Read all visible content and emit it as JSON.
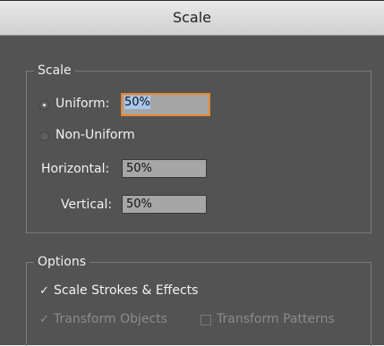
{
  "dialog": {
    "title": "Scale",
    "scale_group": {
      "label": "Scale",
      "uniform_label": "Uniform:",
      "uniform_value": "50%",
      "non_uniform_label": "Non-Uniform",
      "horizontal_label": "Horizontal:",
      "horizontal_value": "50%",
      "vertical_label": "Vertical:",
      "vertical_value": "50%",
      "selected": "uniform"
    },
    "options_group": {
      "label": "Options",
      "scale_strokes_label": "Scale Strokes & Effects",
      "scale_strokes_checked": true,
      "transform_objects_label": "Transform Objects",
      "transform_objects_checked": true,
      "transform_objects_enabled": false,
      "transform_patterns_label": "Transform Patterns",
      "transform_patterns_checked": false,
      "transform_patterns_enabled": false
    }
  },
  "colors": {
    "panel": "#535353",
    "focus": "#e8882c",
    "selection": "#a9c7ee"
  }
}
